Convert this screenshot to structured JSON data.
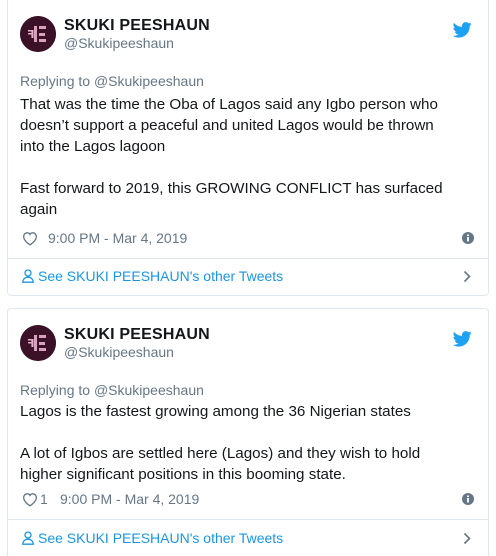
{
  "tweets": [
    {
      "author_name": "SKUKI PEESHAUN",
      "handle": "@Skukipeeshaun",
      "replying_prefix": "Replying to",
      "replying_to": "@Skukipeeshaun",
      "text": "That was the time the Oba of Lagos said any Igbo person who\ndoesn’t support a peaceful and united Lagos would be thrown\ninto the Lagos lagoon\n\nFast forward to 2019, this GROWING CONFLICT has surfaced\nagain",
      "likes": "",
      "timestamp": "9:00 PM - Mar 4, 2019",
      "other_tweets_label": "See SKUKI PEESHAUN's other Tweets"
    },
    {
      "author_name": "SKUKI PEESHAUN",
      "handle": "@Skukipeeshaun",
      "replying_prefix": "Replying to",
      "replying_to": "@Skukipeeshaun",
      "text": "Lagos is the fastest growing among the 36 Nigerian states\n\nA lot of Igbos are settled here (Lagos) and they wish to hold\nhigher significant positions in this booming state.",
      "likes": "1",
      "timestamp": "9:00 PM - Mar 4, 2019",
      "other_tweets_label": "See SKUKI PEESHAUN's other Tweets"
    }
  ],
  "icons": {
    "brand": "twitter-bird-icon",
    "like": "heart-icon",
    "info": "info-icon",
    "profile": "person-icon",
    "next": "chevron-right-icon"
  },
  "colors": {
    "twitter_blue": "#1da1f2",
    "link_blue": "#1b95e0",
    "muted_gray": "#657786",
    "text_dark": "#14171a",
    "border": "#e1e8ed"
  }
}
